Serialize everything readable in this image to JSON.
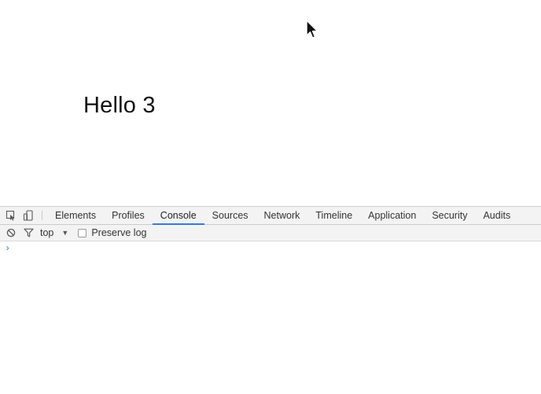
{
  "page": {
    "heading": "Hello 3"
  },
  "devtools": {
    "tabs": [
      {
        "label": "Elements"
      },
      {
        "label": "Profiles"
      },
      {
        "label": "Console",
        "active": true
      },
      {
        "label": "Sources"
      },
      {
        "label": "Network"
      },
      {
        "label": "Timeline"
      },
      {
        "label": "Application"
      },
      {
        "label": "Security"
      },
      {
        "label": "Audits"
      }
    ],
    "console_toolbar": {
      "context": "top",
      "preserve_log_label": "Preserve log",
      "preserve_log_checked": false
    },
    "console": {
      "prompt": "›"
    }
  },
  "colors": {
    "accent": "#3879d9",
    "toolbar_bg": "#f3f3f3"
  }
}
